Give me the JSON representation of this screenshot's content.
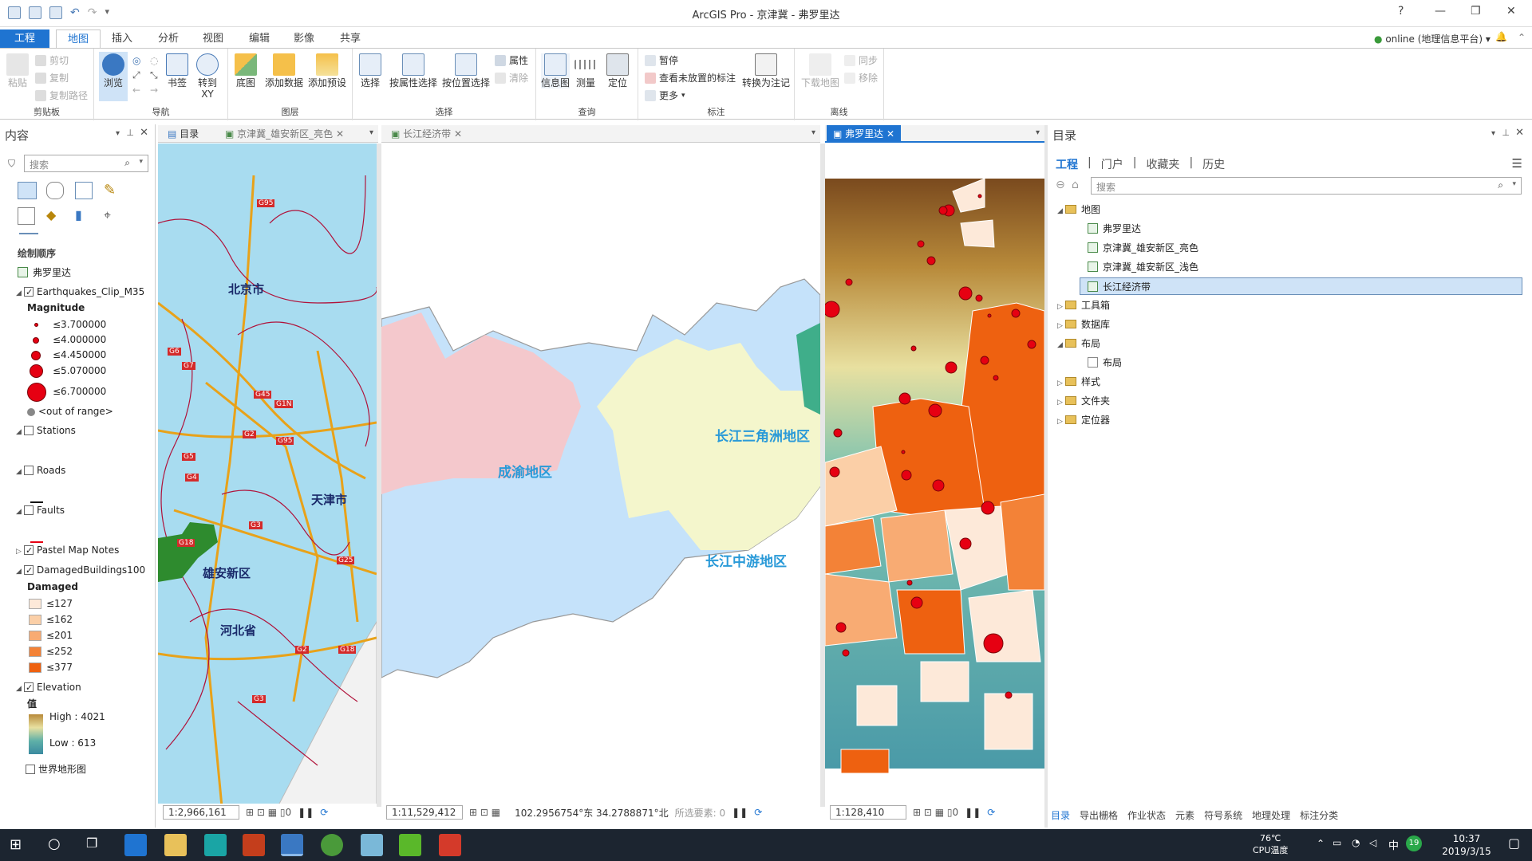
{
  "window": {
    "title": "ArcGIS Pro - 京津冀 - 弗罗里达",
    "help": "?",
    "min": "—",
    "restore": "❐",
    "close": "✕"
  },
  "ribbon_tabs": [
    "工程",
    "地图",
    "插入",
    "分析",
    "视图",
    "编辑",
    "影像",
    "共享"
  ],
  "active_tab": "地图",
  "user": "online (地理信息平台) ▾",
  "ribbon": {
    "clipboard": {
      "paste": "粘贴",
      "cut": "剪切",
      "copy": "复制",
      "copy_path": "复制路径",
      "label": "剪贴板"
    },
    "navigate": {
      "explore": "浏览",
      "bookmarks": "书签",
      "goto": "转到\nXY",
      "label": "导航"
    },
    "layer": {
      "basemap": "底图",
      "add_data": "添加数据",
      "add_preset": "添加预设",
      "label": "图层"
    },
    "selection": {
      "select": "选择",
      "by_attr": "按属性选择",
      "by_loc": "按位置选择",
      "attributes": "属性",
      "clear": "清除",
      "label": "选择"
    },
    "inquiry": {
      "infer": "信息图",
      "measure": "测量",
      "locate": "定位",
      "label": "查询"
    },
    "labeling": {
      "pause": "暂停",
      "view_unplaced": "查看未放置的标注",
      "more": "更多",
      "convert": "转换为注记",
      "label": "标注"
    },
    "offline": {
      "download": "下载地图",
      "sync": "同步",
      "remove": "移除",
      "label": "离线"
    }
  },
  "contents": {
    "title": "内容",
    "search_placeholder": "搜索",
    "drawing_order": "绘制顺序",
    "map_name": "弗罗里达",
    "layers": {
      "earthquakes": "Earthquakes_Clip_M35",
      "magnitude": "Magnitude",
      "mag_classes": [
        "≤3.700000",
        "≤4.000000",
        "≤4.450000",
        "≤5.070000",
        "≤6.700000"
      ],
      "out_of_range": "<out of range>",
      "stations": "Stations",
      "roads": "Roads",
      "faults": "Faults",
      "notes": "Pastel Map Notes",
      "damaged": "DamagedBuildings100",
      "damaged_label": "Damaged",
      "damaged_classes": [
        "≤127",
        "≤162",
        "≤201",
        "≤252",
        "≤377"
      ],
      "damaged_colors": [
        "#fde9d9",
        "#fbcfa7",
        "#f8ab73",
        "#f38237",
        "#ee6110"
      ],
      "elevation": "Elevation",
      "value_label": "值",
      "high": "High : 4021",
      "low": "Low : 613",
      "world_terrain": "世界地形图"
    }
  },
  "map_tabs": {
    "tab1": "目录",
    "tab2": "京津冀_雄安新区_亮色",
    "tab3": "长江经济带",
    "tab4": "弗罗里达"
  },
  "map1": {
    "labels": [
      "北京市",
      "天津市",
      "雄安新区",
      "河北省"
    ],
    "roads": [
      "G95",
      "G6",
      "G7",
      "G45",
      "G1N",
      "G2",
      "G95",
      "G5",
      "G4",
      "G3",
      "G18",
      "G25",
      "G2",
      "G18",
      "G3"
    ],
    "scale": "1:2,966,161"
  },
  "map2": {
    "labels": [
      "成渝地区",
      "长江三角洲地区",
      "长江中游地区"
    ],
    "scale": "1:11,529,412",
    "coords": "102.2956754°东 34.2788871°北",
    "selected": "所选要素: 0"
  },
  "map3": {
    "scale": "1:128,410"
  },
  "catalog": {
    "title": "目录",
    "tabs": [
      "工程",
      "门户",
      "收藏夹",
      "历史"
    ],
    "search_placeholder": "搜索",
    "tree": {
      "maps": "地图",
      "map_items": [
        "弗罗里达",
        "京津冀_雄安新区_亮色",
        "京津冀_雄安新区_浅色",
        "长江经济带"
      ],
      "toolboxes": "工具箱",
      "databases": "数据库",
      "layouts": "布局",
      "layout_item": "布局",
      "styles": "样式",
      "folders": "文件夹",
      "locators": "定位器"
    },
    "bottom_tabs": [
      "目录",
      "导出栅格",
      "作业状态",
      "元素",
      "符号系统",
      "地理处理",
      "标注分类"
    ]
  },
  "taskbar": {
    "temp": "76℃",
    "cpu": "CPU温度",
    "ime": "中",
    "badge": "19",
    "time": "10:37",
    "date": "2019/3/15"
  }
}
